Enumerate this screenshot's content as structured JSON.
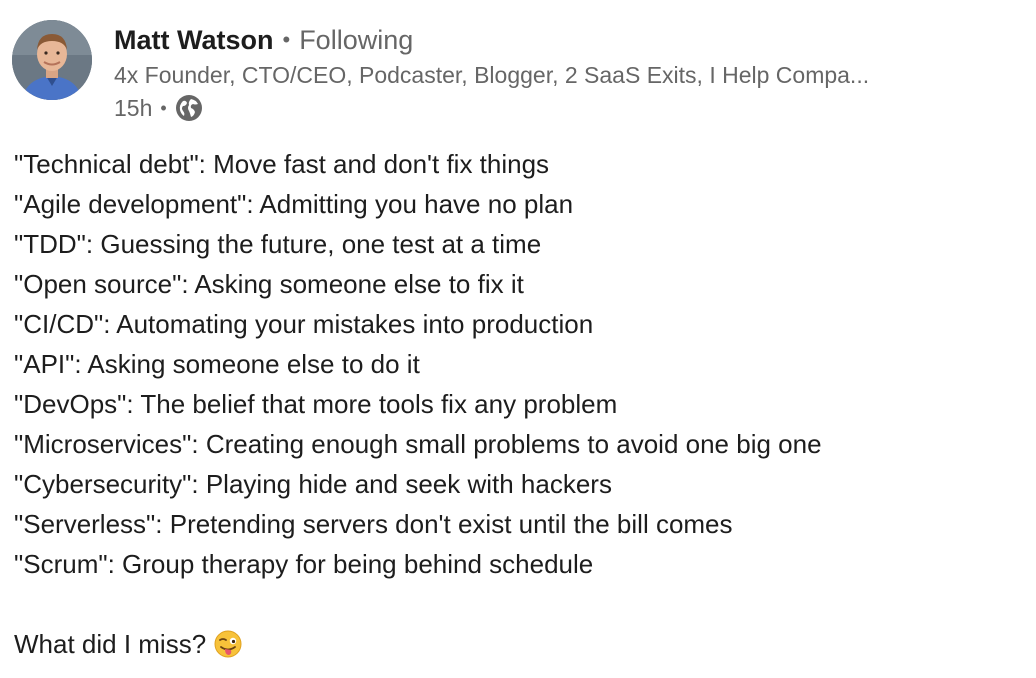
{
  "author": {
    "name": "Matt Watson",
    "separator": "•",
    "follow_status": "Following",
    "headline": "4x Founder, CTO/CEO, Podcaster, Blogger, 2 SaaS Exits, I Help Compa...",
    "time": "15h",
    "time_separator": "•",
    "visibility_icon": "globe-icon",
    "avatar_icon": "avatar-photo"
  },
  "post": {
    "lines": [
      "\"Technical debt\": Move fast and don't fix things",
      "\"Agile development\": Admitting you have no plan",
      "\"TDD\": Guessing the future, one test at a time",
      "\"Open source\": Asking someone else to fix it",
      "\"CI/CD\": Automating your mistakes into production",
      "\"API\": Asking someone else to do it",
      "\"DevOps\": The belief that more tools fix any problem",
      "\"Microservices\": Creating enough small problems to avoid one big one",
      "\"Cybersecurity\": Playing hide and seek with hackers",
      "\"Serverless\": Pretending servers don't exist until the bill comes",
      "\"Scrum\": Group therapy for being behind schedule"
    ],
    "closing": "What did I miss?",
    "closing_emoji": "winking-face-with-tongue-emoji"
  },
  "colors": {
    "text_primary": "#1d1d1d",
    "text_secondary": "#666666",
    "background": "#ffffff"
  }
}
